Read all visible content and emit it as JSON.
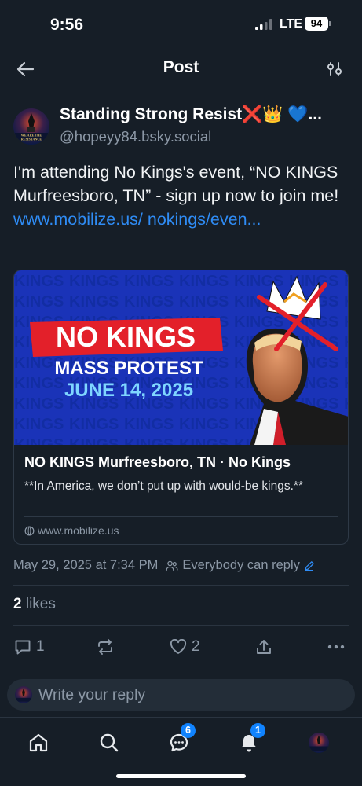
{
  "status_bar": {
    "time": "9:56",
    "network": "LTE",
    "battery": "94"
  },
  "header": {
    "title": "Post",
    "back_icon": "arrow-left-icon",
    "filter_icon": "sliders-icon"
  },
  "post": {
    "author_name": "Standing Strong Resist❌👑 💙...",
    "author_handle": "@hopeyy84.bsky.social",
    "avatar_text": "WE ARE THE RESISTANCE",
    "text": "I'm attending No Kings's event, “NO KINGS Murfreesboro, TN” - sign up now to join me! ",
    "link_text": "www.mobilize.us/ nokings/even...",
    "timestamp": "May 29, 2025 at 7:34 PM",
    "reply_setting": "Everybody can reply",
    "likes_count": "2",
    "likes_label": "likes"
  },
  "embed": {
    "image_title": "NO KINGS",
    "image_subtitle": "MASS PROTEST",
    "image_date": "JUNE 14, 2025",
    "title": "NO KINGS Murfreesboro, TN · No Kings",
    "description": "**In America, we don’t put up with would-be kings.**",
    "domain": "www.mobilize.us"
  },
  "actions": {
    "replies": "1",
    "reposts": "",
    "likes": "2"
  },
  "reply_bar": {
    "placeholder": "Write your reply"
  },
  "tab_bar": {
    "chat_badge": "6",
    "notifications_badge": "1"
  },
  "colors": {
    "background": "#161e27",
    "accent": "#2f8cf5",
    "badge": "#1083fe",
    "muted": "#8c98a6"
  }
}
